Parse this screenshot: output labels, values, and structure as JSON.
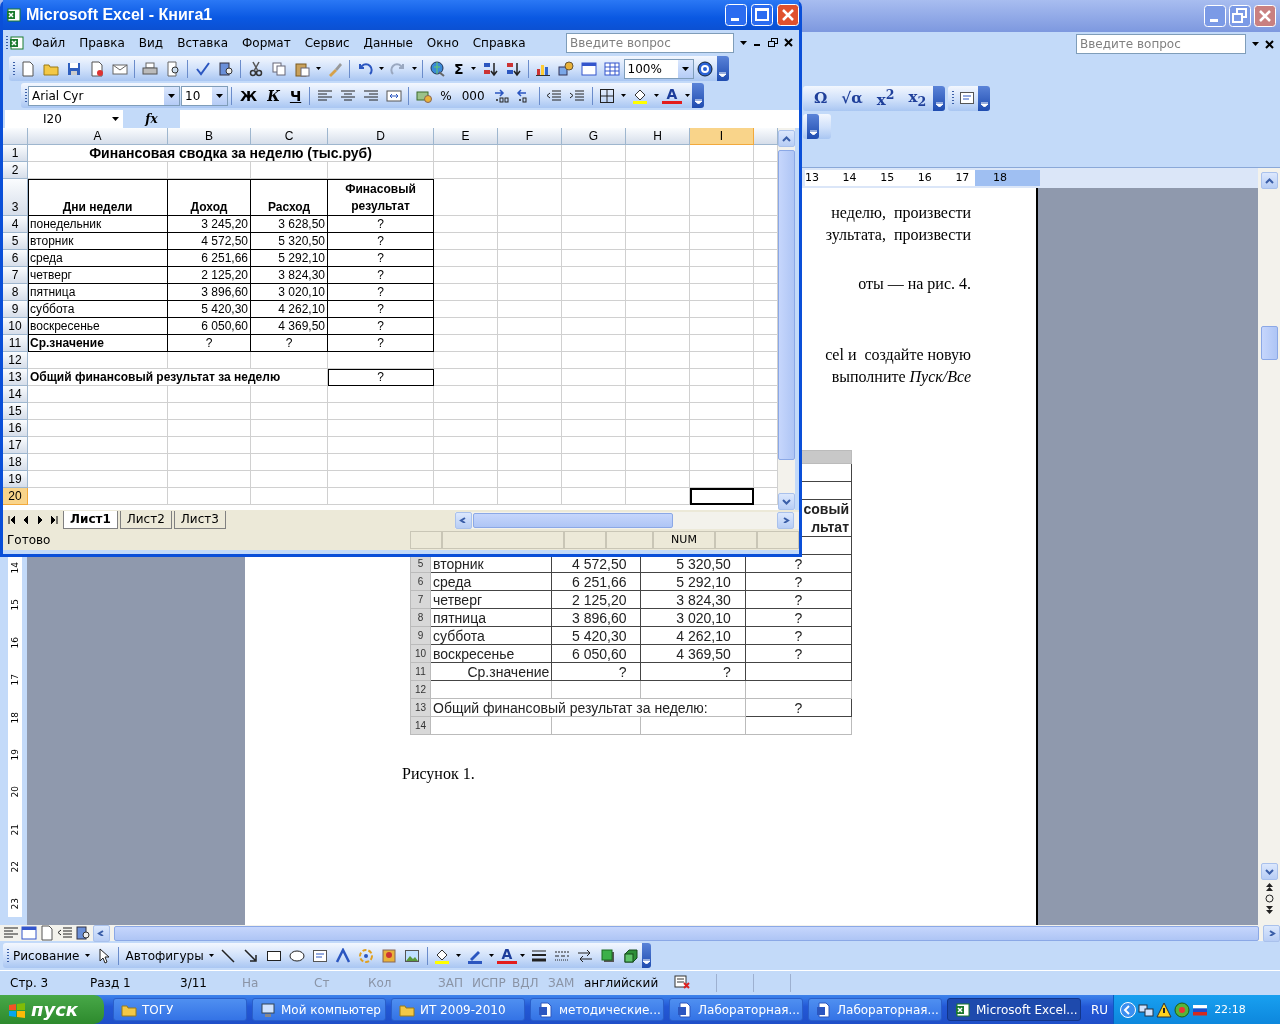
{
  "word_window": {
    "help_search": {
      "placeholder": "Введите вопрос"
    },
    "symbol_toolbar": [
      {
        "label": "Ω"
      },
      {
        "label": "√α"
      },
      {
        "label": "x$^{2}$"
      },
      {
        "label": "x$_{2}$"
      }
    ],
    "ruler": [
      "13",
      "14",
      "15",
      "16",
      "17",
      "18"
    ],
    "vertical_ruler": [
      "14",
      "15",
      "16",
      "17",
      "18",
      "19",
      "20",
      "21",
      "22",
      "23"
    ],
    "document": {
      "paragraphs": [
        [
          "неделю,  произвести",
          "зультата,  произвести"
        ],
        [
          "оты — на рис. 4."
        ],
        [
          "cel и  создайте новую",
          "выполните *Пуск/Все*"
        ]
      ],
      "figure": {
        "header_fragment": [
          "совый",
          "льтат"
        ],
        "rows": [
          {
            "number": "5",
            "kind": "data",
            "label": "вторник",
            "income": "4 572,50",
            "expense": "5 320,50",
            "result": "?"
          },
          {
            "number": "6",
            "kind": "data",
            "label": "среда",
            "income": "6 251,66",
            "expense": "5 292,10",
            "result": "?"
          },
          {
            "number": "7",
            "kind": "data",
            "label": "четверг",
            "income": "2 125,20",
            "expense": "3 824,30",
            "result": "?"
          },
          {
            "number": "8",
            "kind": "data",
            "label": "пятница",
            "income": "3 896,60",
            "expense": "3 020,10",
            "result": "?"
          },
          {
            "number": "9",
            "kind": "data",
            "label": "суббота",
            "income": "5 420,30",
            "expense": "4 262,10",
            "result": "?"
          },
          {
            "number": "10",
            "kind": "data",
            "label": "воскресенье",
            "income": "6 050,60",
            "expense": "4 369,50",
            "result": "?"
          },
          {
            "number": "11",
            "kind": "average",
            "label": "Ср.значение",
            "income": "?",
            "expense": "?"
          },
          {
            "number": "12",
            "kind": "blank"
          },
          {
            "number": "13",
            "kind": "total",
            "label": "Общий финансовый результат за неделю:",
            "result": "?"
          },
          {
            "number": "14",
            "kind": "blank"
          }
        ]
      },
      "caption": "Рисунок 1."
    },
    "drawing_toolbar": {
      "draw_menu": "Рисование",
      "autoshapes_menu": "Автофигуры",
      "font_color_label": "A"
    },
    "status_bar": [
      {
        "text": "Стр. 3",
        "disabled": false
      },
      {
        "text": "Разд 1",
        "disabled": false
      },
      {
        "text": "3/11",
        "disabled": false
      },
      {
        "text": "На",
        "disabled": true
      },
      {
        "text": "Ст",
        "disabled": true
      },
      {
        "text": "Кол",
        "disabled": true
      },
      {
        "text": "ЗАП",
        "disabled": true
      },
      {
        "text": "ИСПР",
        "disabled": true
      },
      {
        "text": "ВДЛ",
        "disabled": true
      },
      {
        "text": "ЗАМ",
        "disabled": true
      },
      {
        "text": "английский",
        "disabled": false
      }
    ]
  },
  "excel_window": {
    "title": "Microsoft Excel - Книга1",
    "menu": [
      {
        "label": "Файл"
      },
      {
        "label": "Правка"
      },
      {
        "label": "Вид"
      },
      {
        "label": "Вставка"
      },
      {
        "label": "Формат"
      },
      {
        "label": "Сервис"
      },
      {
        "label": "Данные"
      },
      {
        "label": "Окно"
      },
      {
        "label": "Справка"
      }
    ],
    "help_search": {
      "placeholder": "Введите вопрос"
    },
    "sum_label": "Σ",
    "zoom": "100%",
    "font": "Arial Cyr",
    "font_size": "10",
    "style_buttons": [
      "Ж",
      "К",
      "Ч"
    ],
    "number_buttons": [
      "%",
      "000"
    ],
    "font_color_label": "A",
    "name_box": "I20",
    "function_label": "fx",
    "columns": [
      {
        "label": "A",
        "selected": false
      },
      {
        "label": "B",
        "selected": false
      },
      {
        "label": "C",
        "selected": false
      },
      {
        "label": "D",
        "selected": false
      },
      {
        "label": "E",
        "selected": false
      },
      {
        "label": "F",
        "selected": false
      },
      {
        "label": "G",
        "selected": false
      },
      {
        "label": "H",
        "selected": false
      },
      {
        "label": "I",
        "selected": true
      }
    ],
    "rows": [
      {
        "number": "1",
        "selected": false,
        "kind": "title",
        "A": "Финансовая сводка  за неделю (тыс.руб)"
      },
      {
        "number": "2",
        "selected": false,
        "kind": "blank"
      },
      {
        "number": "3",
        "selected": false,
        "kind": "header",
        "A": "Дни недели",
        "B": "Доход",
        "C": "Расход",
        "D": "Финасовый результат"
      },
      {
        "number": "4",
        "selected": false,
        "kind": "data",
        "A": "понедельник",
        "B": "3 245,20",
        "C": "3 628,50",
        "D": "?"
      },
      {
        "number": "5",
        "selected": false,
        "kind": "data",
        "A": "вторник",
        "B": "4 572,50",
        "C": "5 320,50",
        "D": "?"
      },
      {
        "number": "6",
        "selected": false,
        "kind": "data",
        "A": "среда",
        "B": "6 251,66",
        "C": "5 292,10",
        "D": "?"
      },
      {
        "number": "7",
        "selected": false,
        "kind": "data",
        "A": "четверг",
        "B": "2 125,20",
        "C": "3 824,30",
        "D": "?"
      },
      {
        "number": "8",
        "selected": false,
        "kind": "data",
        "A": "пятница",
        "B": "3 896,60",
        "C": "3 020,10",
        "D": "?"
      },
      {
        "number": "9",
        "selected": false,
        "kind": "data",
        "A": "суббота",
        "B": "5 420,30",
        "C": "4 262,10",
        "D": "?"
      },
      {
        "number": "10",
        "selected": false,
        "kind": "data",
        "A": "воскресенье",
        "B": "6 050,60",
        "C": "4 369,50",
        "D": "?"
      },
      {
        "number": "11",
        "selected": false,
        "kind": "summary",
        "A": "Ср.значение",
        "B": "?",
        "C": "?",
        "D": "?"
      },
      {
        "number": "12",
        "selected": false,
        "kind": "blank"
      },
      {
        "number": "13",
        "selected": false,
        "kind": "total",
        "A": "Общий финансовый результат за неделю",
        "D": "?"
      },
      {
        "number": "14",
        "selected": false,
        "kind": "blank"
      },
      {
        "number": "15",
        "selected": false,
        "kind": "blank"
      },
      {
        "number": "16",
        "selected": false,
        "kind": "blank"
      },
      {
        "number": "17",
        "selected": false,
        "kind": "blank"
      },
      {
        "number": "18",
        "selected": false,
        "kind": "blank"
      },
      {
        "number": "19",
        "selected": false,
        "kind": "blank"
      },
      {
        "number": "20",
        "selected": true,
        "kind": "blank"
      }
    ],
    "sheets": [
      {
        "label": "Лист1",
        "selected": true
      },
      {
        "label": "Лист2",
        "selected": false
      },
      {
        "label": "Лист3",
        "selected": false
      }
    ],
    "status": "Готово",
    "indicators": [
      "NUM"
    ]
  },
  "taskbar": {
    "start_label": "пуск",
    "buttons": [
      {
        "label": "ТОГУ",
        "kind": "folder",
        "selected": false
      },
      {
        "label": "Мой компьютер",
        "kind": "computer",
        "selected": false
      },
      {
        "label": "ИТ 2009-2010",
        "kind": "folder",
        "selected": false
      },
      {
        "label": "методические...",
        "kind": "document",
        "selected": false
      },
      {
        "label": "Лабораторная...",
        "kind": "document",
        "selected": false
      },
      {
        "label": "Лабораторная...",
        "kind": "document",
        "selected": false
      },
      {
        "label": "Microsoft Excel...",
        "kind": "spreadsheet",
        "selected": true
      }
    ],
    "language": "RU",
    "clock": "22:18"
  }
}
